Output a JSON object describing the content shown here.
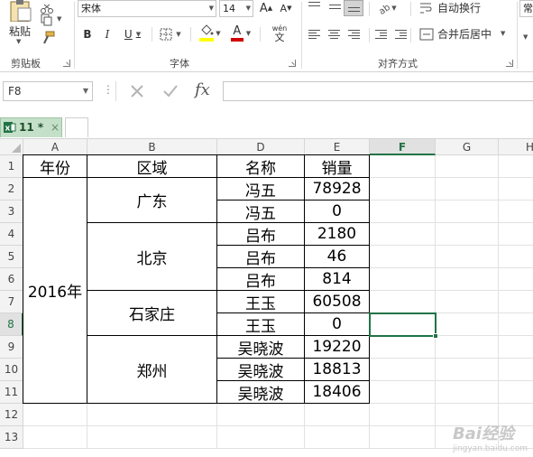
{
  "ribbon": {
    "clipboard": {
      "paste_label": "粘贴",
      "group_label": "剪贴板"
    },
    "font": {
      "font_name": "宋体",
      "font_size": "14",
      "grow_label": "A",
      "shrink_label": "A",
      "bold_label": "B",
      "italic_label": "I",
      "underline_label": "U",
      "highlight_label": "ab",
      "font_color_label": "A",
      "highlight_color": "#ffff00",
      "font_color": "#d00000",
      "phonetic_label": "wén",
      "phonetic_char": "文",
      "group_label": "字体"
    },
    "alignment": {
      "wrap_text_label": "自动换行",
      "merge_center_label": "合并后居中",
      "group_label": "对齐方式"
    },
    "number": {
      "format_label": "常"
    }
  },
  "formula_bar": {
    "name_box": "F8",
    "fx_label": "fx",
    "formula": ""
  },
  "tabs": {
    "document_tab": "11 *",
    "document_tab_close": "×",
    "tab_color": "#c5e0c8"
  },
  "sheet": {
    "columns": [
      "A",
      "B",
      "D",
      "E",
      "F",
      "G",
      "H"
    ],
    "rows": [
      "1",
      "2",
      "3",
      "4",
      "5",
      "6",
      "7",
      "8",
      "9",
      "10",
      "11",
      "12",
      "13"
    ],
    "selected_column": "F",
    "selected_row": "8",
    "headers": {
      "year": "年份",
      "region": "区域",
      "name": "名称",
      "sales": "销量"
    },
    "year_value": "2016年",
    "regions": [
      "广东",
      "北京",
      "石家庄",
      "郑州"
    ],
    "names": [
      "冯五",
      "冯五",
      "吕布",
      "吕布",
      "吕布",
      "王玉",
      "王玉",
      "吴晓波",
      "吴晓波",
      "吴晓波"
    ],
    "sales": [
      "78928",
      "0",
      "2180",
      "46",
      "814",
      "60508",
      "0",
      "19220",
      "18813",
      "18406"
    ],
    "accent_color": "#217346"
  },
  "watermark": {
    "text": "Bai经验",
    "sub": "jingyan.baidu.com"
  }
}
